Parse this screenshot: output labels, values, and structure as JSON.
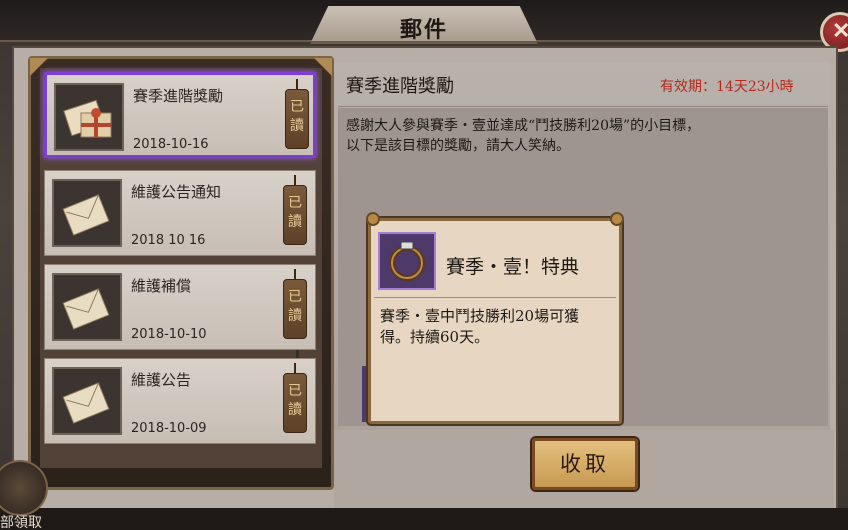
{
  "window": {
    "title": "郵件",
    "close_label": "✕"
  },
  "mail_list": [
    {
      "title": "賽季進階獎勵",
      "date": "2018-10-16",
      "status": "已讀",
      "selected": true,
      "icon": "gift-package-icon"
    },
    {
      "title": "維護公告通知",
      "date": "2018 10 16",
      "status": "已讀",
      "selected": false,
      "icon": "letter-icon"
    },
    {
      "title": "維護補償",
      "date": "2018-10-10",
      "status": "已讀",
      "selected": false,
      "icon": "letter-icon"
    },
    {
      "title": "維護公告",
      "date": "2018-10-09",
      "status": "已讀",
      "selected": false,
      "icon": "letter-icon"
    }
  ],
  "detail": {
    "subject": "賽季進階獎勵",
    "validity": "有效期：14天23小時",
    "body_line1": "感謝大人參與賽季・壹並達成“鬥技勝利20場”的小目標，",
    "body_line2": "以下是該目標的獎勵，請大人笑納。"
  },
  "reward": {
    "icon": "ring-frame-icon",
    "title": "賽季・壹！特典",
    "desc_line1": "賽季・壹中鬥技勝利20場可獲",
    "desc_line2": "得。持續60天。"
  },
  "collect_button": "收取",
  "claim_all": "部領取",
  "colors": {
    "accent_purple": "#7b3ed6",
    "validity_red": "#b8281e",
    "button_gold": "#d8ae66"
  }
}
